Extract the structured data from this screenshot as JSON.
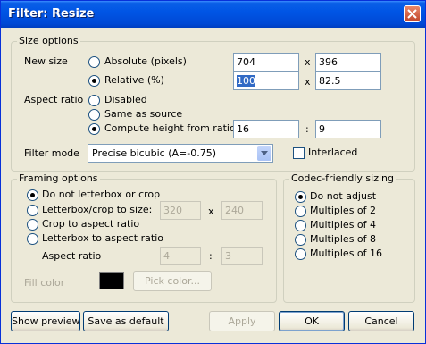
{
  "window": {
    "title": "Filter: Resize"
  },
  "size_options": {
    "legend": "Size options",
    "new_size_label": "New size",
    "absolute_label": "Absolute (pixels)",
    "relative_label": "Relative (%)",
    "absolute_width": "704",
    "absolute_height": "396",
    "relative_width": "100",
    "relative_height": "82.5",
    "times": "x",
    "aspect_ratio_label": "Aspect ratio",
    "disabled_label": "Disabled",
    "same_as_source_label": "Same as source",
    "compute_label": "Compute height from ratio:",
    "ratio_a": "16",
    "ratio_b": "9",
    "colon": ":",
    "filter_mode_label": "Filter mode",
    "filter_mode_value": "Precise bicubic (A=-0.75)",
    "interlaced_label": "Interlaced",
    "size_mode_selected": "relative",
    "aspect_mode_selected": "compute",
    "interlaced_checked": false
  },
  "framing_options": {
    "legend": "Framing options",
    "no_letterbox_label": "Do not letterbox or crop",
    "letterbox_crop_size_label": "Letterbox/crop to size:",
    "crop_to_aspect_label": "Crop to aspect ratio",
    "letterbox_to_aspect_label": "Letterbox to aspect ratio",
    "frame_width": "320",
    "frame_height": "240",
    "times": "x",
    "aspect_ratio_label": "Aspect ratio",
    "aspect_a": "4",
    "aspect_b": "3",
    "colon": ":",
    "fill_color_label": "Fill color",
    "fill_color": "#000000",
    "pick_color_label": "Pick color...",
    "selected": "no_letterbox"
  },
  "codec_sizing": {
    "legend": "Codec-friendly sizing",
    "options": [
      "Do not adjust",
      "Multiples of 2",
      "Multiples of 4",
      "Multiples of 8",
      "Multiples of 16"
    ],
    "selected_index": 0
  },
  "buttons": {
    "show_preview": "Show preview",
    "save_default": "Save as default",
    "apply": "Apply",
    "ok": "OK",
    "cancel": "Cancel"
  },
  "colors": {
    "titlebar": "#0055e5",
    "dialog_bg": "#ece9d8",
    "selection": "#316ac5"
  }
}
